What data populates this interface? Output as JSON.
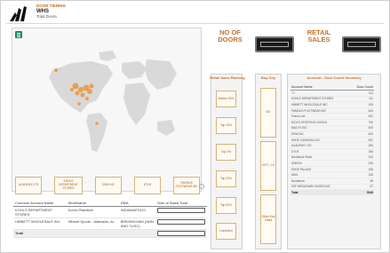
{
  "header": {
    "line1": "DOOR TIERING",
    "line2": "WHS",
    "line3": "Total Doors"
  },
  "map": {
    "menu_icon": "menu-icon",
    "land_color": "#d9d9d9",
    "marker_color": "#e8912e"
  },
  "filters": [
    {
      "label": "ACADEMY LTD"
    },
    {
      "label": "KOHLS DEPARTMENT STORES"
    },
    {
      "label": "DSW INC"
    },
    {
      "label": "DTLR"
    },
    {
      "label": "FAMOUS FOOTWEAR INC"
    }
  ],
  "account_table": {
    "headers": [
      "Common Account Name",
      "StoreName",
      "DMA",
      "Sum of Stand Total"
    ],
    "rows": [
      {
        "account": "KOHLS DEPARTMENT STORES",
        "store": "Kohl's Plainfield",
        "dma": "INDIANAPOLIS"
      },
      {
        "account": "HIBBETT WHOLESALE INC",
        "store": "Hibbett Sports - Alabaster, AL",
        "dma": "BIRMINGHAM (ANN AND TUSC)"
      }
    ],
    "total_label": "Total"
  },
  "kpis": {
    "doors_label": "NO OF DOORS",
    "sales_label": "RETAIL SALES"
  },
  "ranking": {
    "title": "Retail Sales Ranking",
    "buttons": [
      "Bottom 50%",
      "Top 10%",
      "Top 2%",
      "Top 20%",
      "Top 50%",
      "Unranked"
    ]
  },
  "buy_city": {
    "title": "Buy City",
    "buttons": [
      "NO",
      "NYC / LA",
      "Other Key Cities"
    ]
  },
  "summary": {
    "title": "Account - Door Count Summary",
    "col_account": "Account Name",
    "col_count": "Door Count",
    "rows": [
      {
        "name": "TJ",
        "count": "113"
      },
      {
        "name": "KOHLS DEPARTMENT STORES",
        "count": "111"
      },
      {
        "name": "HIBBETT WHOLESALE INC",
        "count": "109"
      },
      {
        "name": "FAMOUS FOOTWEAR INC",
        "count": "543"
      },
      {
        "name": "Finish Line",
        "count": "542"
      },
      {
        "name": "DICKS SPORTING GOODS",
        "count": "790"
      },
      {
        "name": "MACYS INC",
        "count": "400"
      },
      {
        "name": "DSW INC",
        "count": "400"
      },
      {
        "name": "SHOE CARNIVAL INC",
        "count": "387"
      },
      {
        "name": "ACADEMY LTD",
        "count": "280"
      },
      {
        "name": "DTLR",
        "count": "256"
      },
      {
        "name": "Nordstrom Rack",
        "count": "244"
      },
      {
        "name": "SHIEKH",
        "count": "226"
      },
      {
        "name": "SHOE PALACE",
        "count": "185"
      },
      {
        "name": "MDG",
        "count": "135"
      },
      {
        "name": "Nordstrom",
        "count": "98"
      },
      {
        "name": "OFF BROADWAY SHOES INC",
        "count": "97"
      }
    ],
    "total_label": "Total",
    "total_value": "5049"
  }
}
